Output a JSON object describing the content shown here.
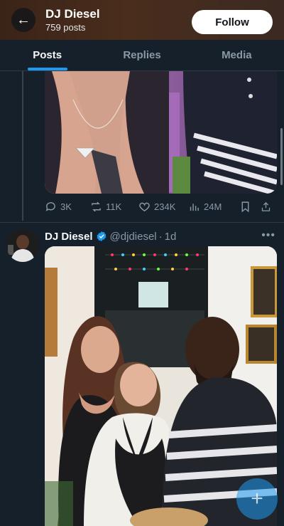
{
  "header": {
    "back_icon": "arrow-left-icon",
    "name": "DJ Diesel",
    "post_count": "759 posts",
    "follow_label": "Follow"
  },
  "tabs": [
    {
      "label": "Posts",
      "active": true
    },
    {
      "label": "Replies",
      "active": false
    },
    {
      "label": "Media",
      "active": false
    }
  ],
  "tweet1": {
    "actions": {
      "replies": "3K",
      "reposts": "11K",
      "likes": "234K",
      "views": "24M"
    }
  },
  "tweet2": {
    "name": "DJ Diesel",
    "handle": "@djdiesel",
    "separator": "·",
    "time": "1d",
    "more_icon": "more-horizontal-icon"
  },
  "colors": {
    "background": "#15202b",
    "accent": "#1d9bf0",
    "muted_text": "#8b98a5"
  }
}
